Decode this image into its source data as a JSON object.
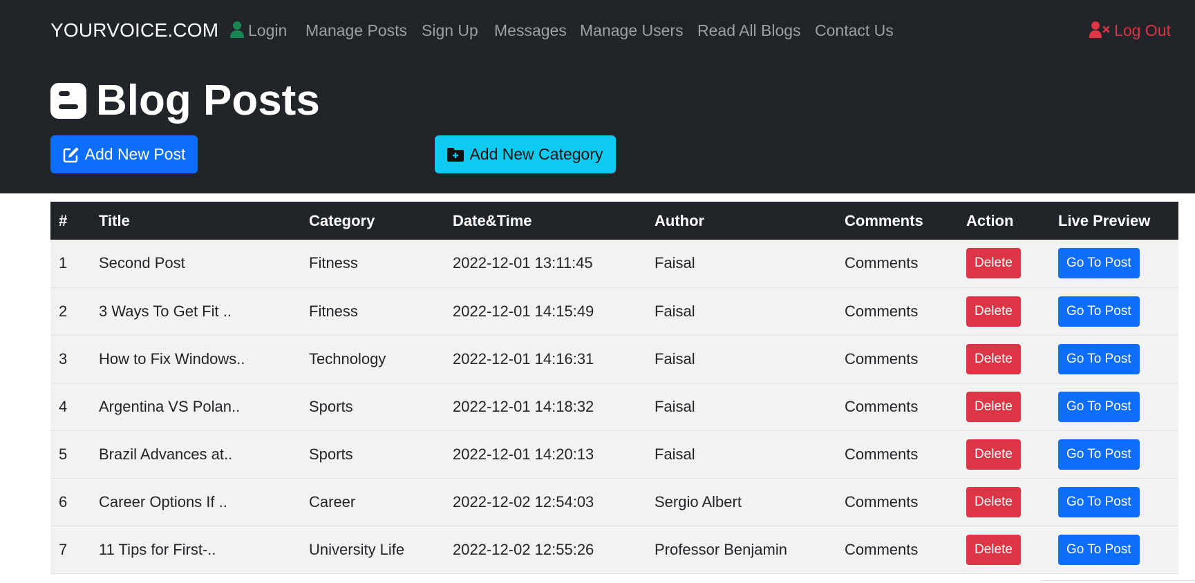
{
  "brand": "YOURVOICE.COM",
  "nav": {
    "login": "Login",
    "manage_posts": "Manage Posts",
    "sign_up": "Sign Up",
    "messages": "Messages",
    "manage_users": "Manage Users",
    "read_all_blogs": "Read All Blogs",
    "contact_us": "Contact Us",
    "log_out": "Log Out"
  },
  "page_title": "Blog Posts",
  "buttons": {
    "add_new_post": "Add New Post",
    "add_new_category": "Add New Category"
  },
  "table": {
    "headers": [
      "#",
      "Title",
      "Category",
      "Date&Time",
      "Author",
      "Comments",
      "Action",
      "Live Preview"
    ],
    "rows": [
      {
        "num": "1",
        "title": "Second Post",
        "category": "Fitness",
        "datetime": "2022-12-01 13:11:45",
        "author": "Faisal",
        "comments": "Comments",
        "action": "Delete",
        "preview": "Go To Post"
      },
      {
        "num": "2",
        "title": "3 Ways To Get Fit ..",
        "category": "Fitness",
        "datetime": "2022-12-01 14:15:49",
        "author": "Faisal",
        "comments": "Comments",
        "action": "Delete",
        "preview": "Go To Post"
      },
      {
        "num": "3",
        "title": "How to Fix Windows..",
        "category": "Technology",
        "datetime": "2022-12-01 14:16:31",
        "author": "Faisal",
        "comments": "Comments",
        "action": "Delete",
        "preview": "Go To Post"
      },
      {
        "num": "4",
        "title": "Argentina VS Polan..",
        "category": "Sports",
        "datetime": "2022-12-01 14:18:32",
        "author": "Faisal",
        "comments": "Comments",
        "action": "Delete",
        "preview": "Go To Post"
      },
      {
        "num": "5",
        "title": "Brazil Advances at..",
        "category": "Sports",
        "datetime": "2022-12-01 14:20:13",
        "author": "Faisal",
        "comments": "Comments",
        "action": "Delete",
        "preview": "Go To Post"
      },
      {
        "num": "6",
        "title": "Career Options If ..",
        "category": "Career",
        "datetime": "2022-12-02 12:54:03",
        "author": "Sergio Albert",
        "comments": "Comments",
        "action": "Delete",
        "preview": "Go To Post"
      },
      {
        "num": "7",
        "title": "11 Tips for First-..",
        "category": "University Life",
        "datetime": "2022-12-02 12:55:26",
        "author": "Professor Benjamin",
        "comments": "Comments",
        "action": "Delete",
        "preview": "Go To Post"
      }
    ]
  },
  "colors": {
    "navbar_bg": "#212529",
    "primary": "#0d6efd",
    "info": "#0dcaf0",
    "danger": "#dc3545",
    "success": "#198754"
  },
  "icons": {
    "login": "user-icon",
    "logout": "user-x-icon",
    "title": "blogger-icon",
    "add_post": "edit-icon",
    "add_category": "folder-plus-icon"
  }
}
